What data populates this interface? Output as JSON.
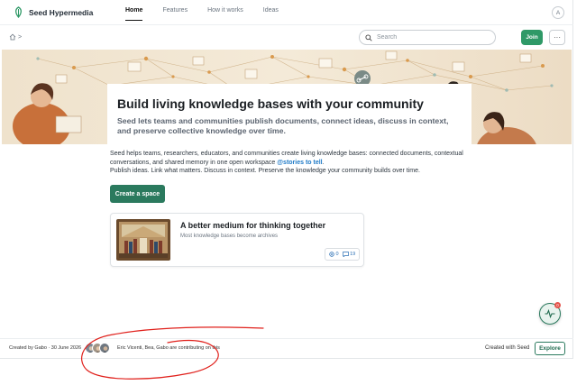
{
  "brand": {
    "name": "Seed Hypermedia"
  },
  "nav": {
    "links": [
      {
        "label": "Home",
        "active": true
      },
      {
        "label": "Features",
        "active": false
      },
      {
        "label": "How it works",
        "active": false
      },
      {
        "label": "Ideas",
        "active": false
      }
    ],
    "account_initial": "A"
  },
  "toolbar": {
    "breadcrumb_sep": ">",
    "search_placeholder": "Search",
    "join_label": "Join",
    "more_label": "···"
  },
  "hero": {
    "title": "Build living knowledge bases with your community",
    "subtitle": "Seed lets teams and communities publish documents, connect ideas, discuss in context, and preserve collective knowledge over time."
  },
  "content": {
    "lead": "Seed helps teams, researchers, educators, and communities create living knowledge bases: connected documents, contextual conversations, and shared memory in one open workspace",
    "mention": "@stories to tell",
    "lead_end": ".",
    "lead2": "Publish ideas. Link what matters. Discuss in context. Preserve the knowledge your community builds over time.",
    "cta_label": "Create a space"
  },
  "card": {
    "title": "A better medium for thinking together",
    "description": "Most knowledge bases become archives",
    "mentions_count": "0",
    "comments_count": "19"
  },
  "activity": {
    "badge": "0"
  },
  "footer": {
    "created": "Created by Gabo · 30 June 2026",
    "contributors": "Eric Vicenti, Bea, Gabo are contributing on this",
    "created_with": "Created with Seed",
    "explore_label": "Explore"
  },
  "colors": {
    "accent": "#2f9967",
    "cta": "#2b7a5e",
    "mention": "#1f7ac7",
    "annotation": "#e0201b"
  }
}
